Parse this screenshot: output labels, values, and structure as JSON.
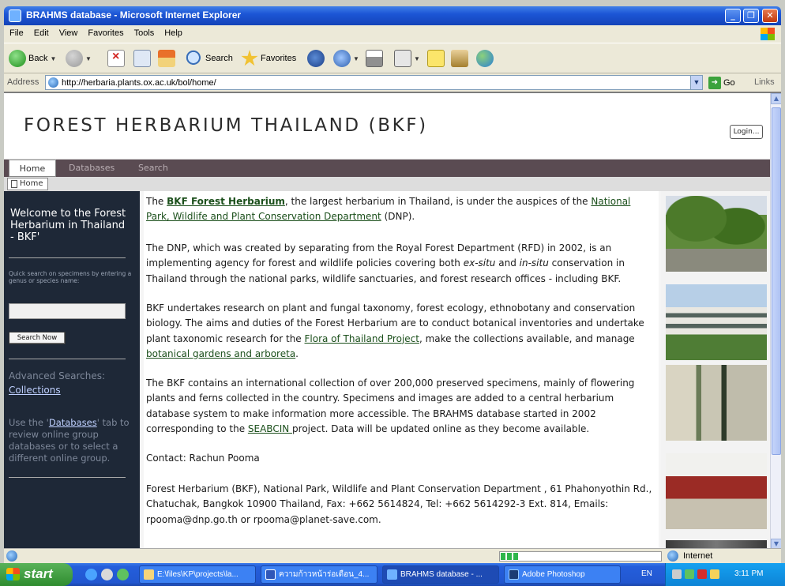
{
  "window": {
    "title": "BRAHMS database - Microsoft Internet Explorer"
  },
  "menu": [
    "File",
    "Edit",
    "View",
    "Favorites",
    "Tools",
    "Help"
  ],
  "toolbar": {
    "back": "Back",
    "search": "Search",
    "favorites": "Favorites"
  },
  "address": {
    "label": "Address",
    "url": "http://herbaria.plants.ox.ac.uk/bol/home/",
    "go": "Go",
    "links": "Links"
  },
  "site": {
    "title": "FOREST HERBARIUM THAILAND (BKF)",
    "login": "Login...",
    "nav": [
      "Home",
      "Databases",
      "Search"
    ],
    "crumb": "Home"
  },
  "sidebar": {
    "welcome": "Welcome to the Forest Herbarium in Thailand - BKF'",
    "quick_search_label": "Quick search on specimens by entering a genus or species name:",
    "search_now": "Search Now",
    "advanced_title": "Advanced Searches:",
    "collections_link": "Collections",
    "use_prefix": "Use the '",
    "databases_link": "Databases",
    "use_suffix": "' tab to review online group databases or to select a different online group."
  },
  "content": {
    "p1_intro": "The ",
    "p1_link": "BKF Forest Herbarium",
    "p1_mid": ", the largest herbarium in Thailand, is under the auspices of the ",
    "p1_link2": "National Park, Wildlife and Plant Conservation Department",
    "p1_end": " (DNP).",
    "p2_a": "The DNP, which was created by separating from the Royal Forest Department (RFD) in 2002, is an implementing agency for forest and wildlife policies covering both ",
    "p2_exsitu": "ex-situ",
    "p2_b": " and ",
    "p2_insitu": "in-situ",
    "p2_c": " conservation in Thailand through the national parks, wildlife sanctuaries, and forest research offices - including BKF.",
    "p3_a": "BKF undertakes research on plant and fungal taxonomy, forest ecology, ethnobotany and conservation biology. The aims and duties of the Forest Herbarium are to conduct botanical inventories and undertake plant taxonomic research for the ",
    "p3_link": "Flora of Thailand Project",
    "p3_b": ", make the collections available, and manage ",
    "p3_link2": "botanical gardens and arboreta",
    "p3_c": ".",
    "p4_a": "The BKF contains an international collection of over 200,000 preserved specimens, mainly of flowering plants and ferns collected in the country. Specimens and images are added to a central herbarium database system to make information more accessible. The BRAHMS database started in 2002 corresponding to the ",
    "p4_link": "SEABCIN ",
    "p4_b": "project. Data will be updated online as they become available.",
    "contact": "Contact: Rachun Pooma",
    "address": "Forest Herbarium (BKF), National Park, Wildlife and Plant Conservation Department , 61 Phahonyothin Rd., Chatuchak, Bangkok 10900 Thailand, Fax: +662 5614824, Tel: +662 5614292-3 Ext. 814, Emails: rpooma@dnp.go.th or rpooma@planet-save.com."
  },
  "statusbar": {
    "zone": "Internet",
    "progress_fraction": 0.12
  },
  "taskbar": {
    "start": "start",
    "tasks": [
      "E:\\files\\KP\\projects\\la...",
      "ความก้าวหน้าร่อเดือน_4...",
      "BRAHMS database - ...",
      "Adobe Photoshop"
    ],
    "lang": "EN",
    "clock": "3:11 PM"
  },
  "colors": {
    "titlebar": "#1c56d6",
    "nav": "#5a4b52",
    "sidebar": "#1e2837",
    "link": "#1b4f1b",
    "taskbar": "#245edb"
  }
}
